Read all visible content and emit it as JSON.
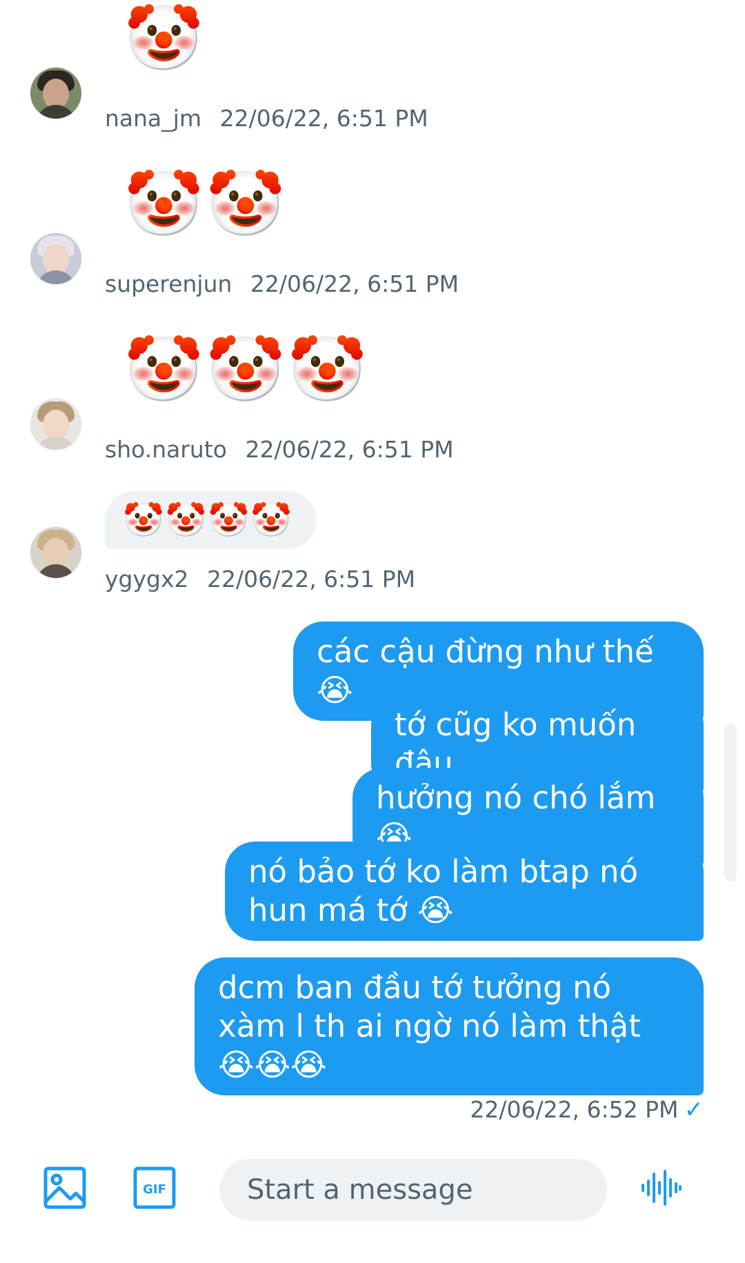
{
  "thread": {
    "incoming": [
      {
        "username": "nana_jm",
        "timestamp": "22/06/22, 6:51 PM",
        "content": "🤡",
        "style": "emoji"
      },
      {
        "username": "superenjun",
        "timestamp": "22/06/22, 6:51 PM",
        "content": "🤡🤡",
        "style": "emoji"
      },
      {
        "username": "sho.naruto",
        "timestamp": "22/06/22, 6:51 PM",
        "content": "🤡🤡🤡",
        "style": "emoji"
      },
      {
        "username": "ygygx2",
        "timestamp": "22/06/22, 6:51 PM",
        "content": "🤡🤡🤡🤡",
        "style": "bubble"
      }
    ],
    "outgoing": [
      {
        "text": "các cậu đừng như thế 😭"
      },
      {
        "text": "tớ cũg ko muốn đâu"
      },
      {
        "text": "hưởng nó chó lắm 😭"
      },
      {
        "text": "nó bảo tớ ko làm btap nó hun má tớ 😭"
      },
      {
        "text": "dcm ban đầu tớ tưởng nó xàm l th ai ngờ nó làm thật 😭😭😭"
      }
    ],
    "sent_timestamp": "22/06/22, 6:52 PM",
    "sent_status_icon": "check-icon"
  },
  "composer": {
    "placeholder": "Start a message",
    "gif_label": "GIF",
    "media_icon": "image-icon",
    "voice_icon": "voice-waveform-icon"
  },
  "colors": {
    "accent": "#1d9bf0",
    "received_bubble": "#eef2f5",
    "meta_text": "#536471"
  }
}
